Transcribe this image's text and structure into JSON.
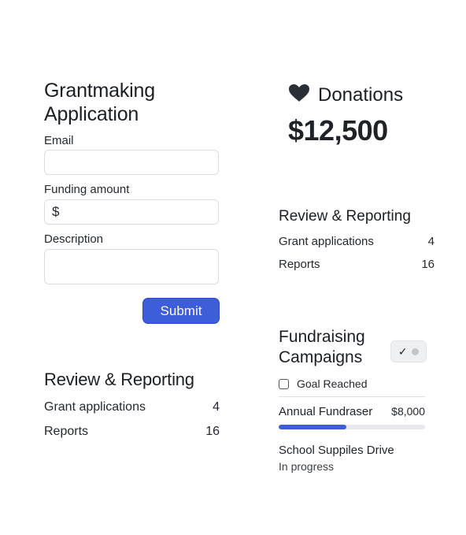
{
  "grant_form": {
    "title": "Grantmaking Application",
    "email_label": "Email",
    "email_value": "",
    "funding_label": "Funding amount",
    "funding_prefix": "$",
    "funding_value": "",
    "description_label": "Description",
    "description_value": "",
    "submit_label": "Submit",
    "accent_color": "#3e5ddb"
  },
  "review_left": {
    "title": "Review & Reporting",
    "rows": [
      {
        "label": "Grant applications",
        "value": "4"
      },
      {
        "label": "Reports",
        "value": "16"
      }
    ]
  },
  "donations": {
    "icon": "heart-icon",
    "title": "Donations",
    "amount": "$12,500"
  },
  "review_right": {
    "title": "Review & Reporting",
    "rows": [
      {
        "label": "Grant applications",
        "value": "4"
      },
      {
        "label": "Reports",
        "value": "16"
      }
    ]
  },
  "fundraising": {
    "title": "Fundraising Campaigns",
    "toggle_icon": "checkmark-icon",
    "goal_checkbox_label": "Goal Reached",
    "campaigns": [
      {
        "name": "Annual Fundraser",
        "amount": "$8,000",
        "progress": 0.46
      },
      {
        "name": "School Suppiles Drive",
        "status": "In progress"
      }
    ]
  }
}
